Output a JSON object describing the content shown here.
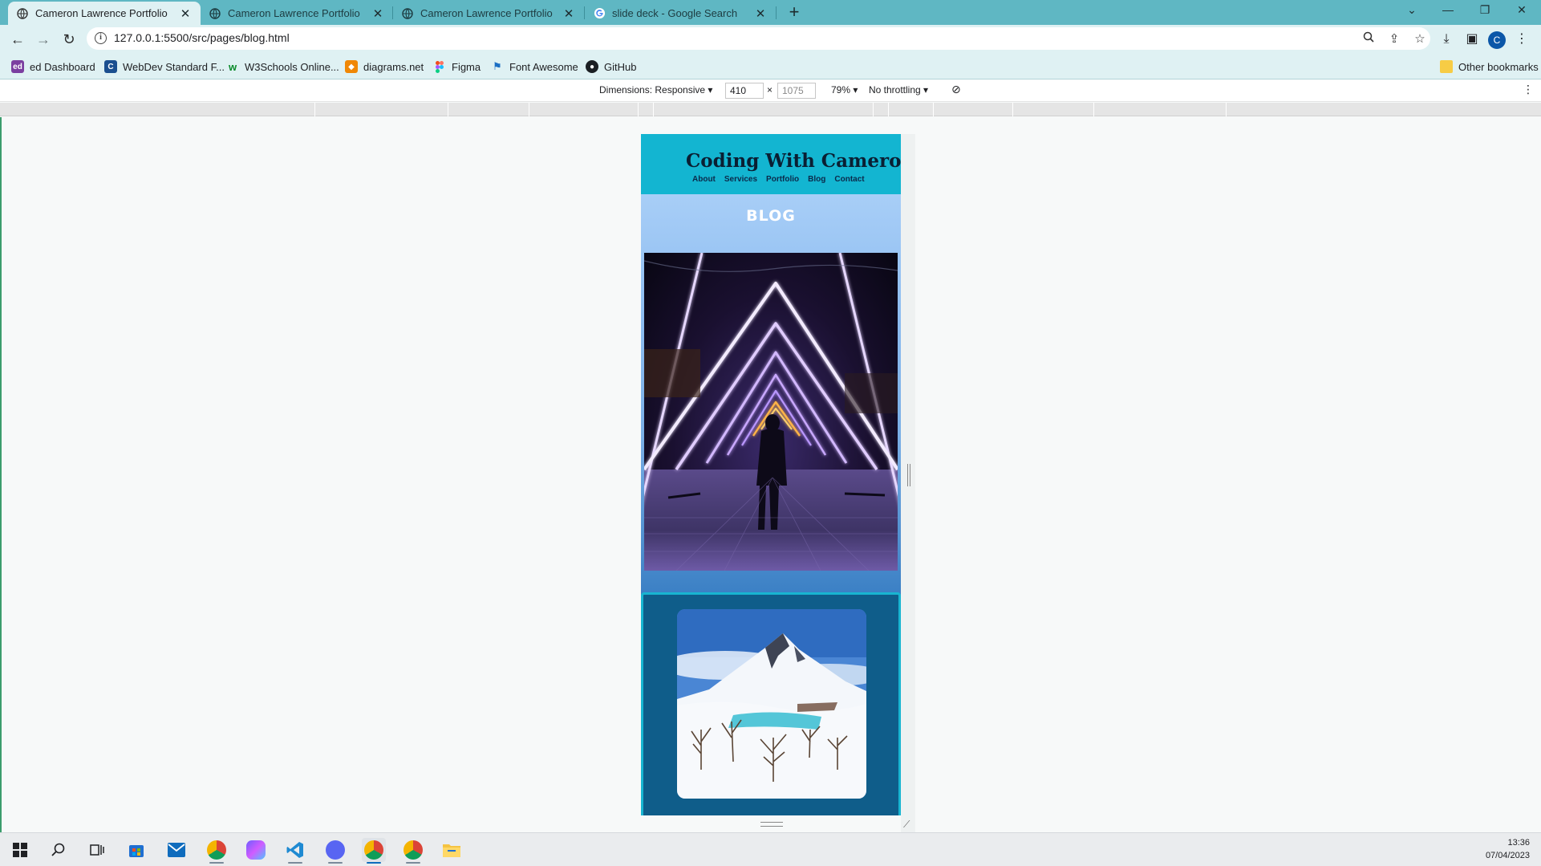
{
  "browser": {
    "tabs": [
      {
        "title": "Cameron Lawrence Portfolio",
        "active": true
      },
      {
        "title": "Cameron Lawrence Portfolio",
        "active": false
      },
      {
        "title": "Cameron Lawrence Portfolio",
        "active": false
      },
      {
        "title": "slide deck - Google Search",
        "active": false
      }
    ],
    "url": "127.0.0.1:5500/src/pages/blog.html",
    "profile_initial": "C",
    "bookmarks": [
      {
        "label": "ed Dashboard",
        "icon": "ed-icon"
      },
      {
        "label": "WebDev Standard F...",
        "icon": "webdev-icon"
      },
      {
        "label": "W3Schools Online...",
        "icon": "w3schools-icon"
      },
      {
        "label": "diagrams.net",
        "icon": "diagrams-icon"
      },
      {
        "label": "Figma",
        "icon": "figma-icon"
      },
      {
        "label": "Font Awesome",
        "icon": "font-awesome-icon"
      },
      {
        "label": "GitHub",
        "icon": "github-icon"
      }
    ],
    "other_bookmarks": "Other bookmarks"
  },
  "devtools": {
    "dimensions_label": "Dimensions: Responsive",
    "width": "410",
    "height": "1075",
    "zoom": "79%",
    "throttling": "No throttling"
  },
  "site": {
    "title": "Coding With Cameron",
    "nav": [
      "About",
      "Services",
      "Portfolio",
      "Blog",
      "Contact"
    ],
    "hero_heading": "BLOG",
    "colors": {
      "header": "#13b5d1",
      "card": "#0f5d8a",
      "card_border": "#18b5d1"
    }
  },
  "taskbar": {
    "time": "13:36",
    "date": "07/04/2023"
  }
}
